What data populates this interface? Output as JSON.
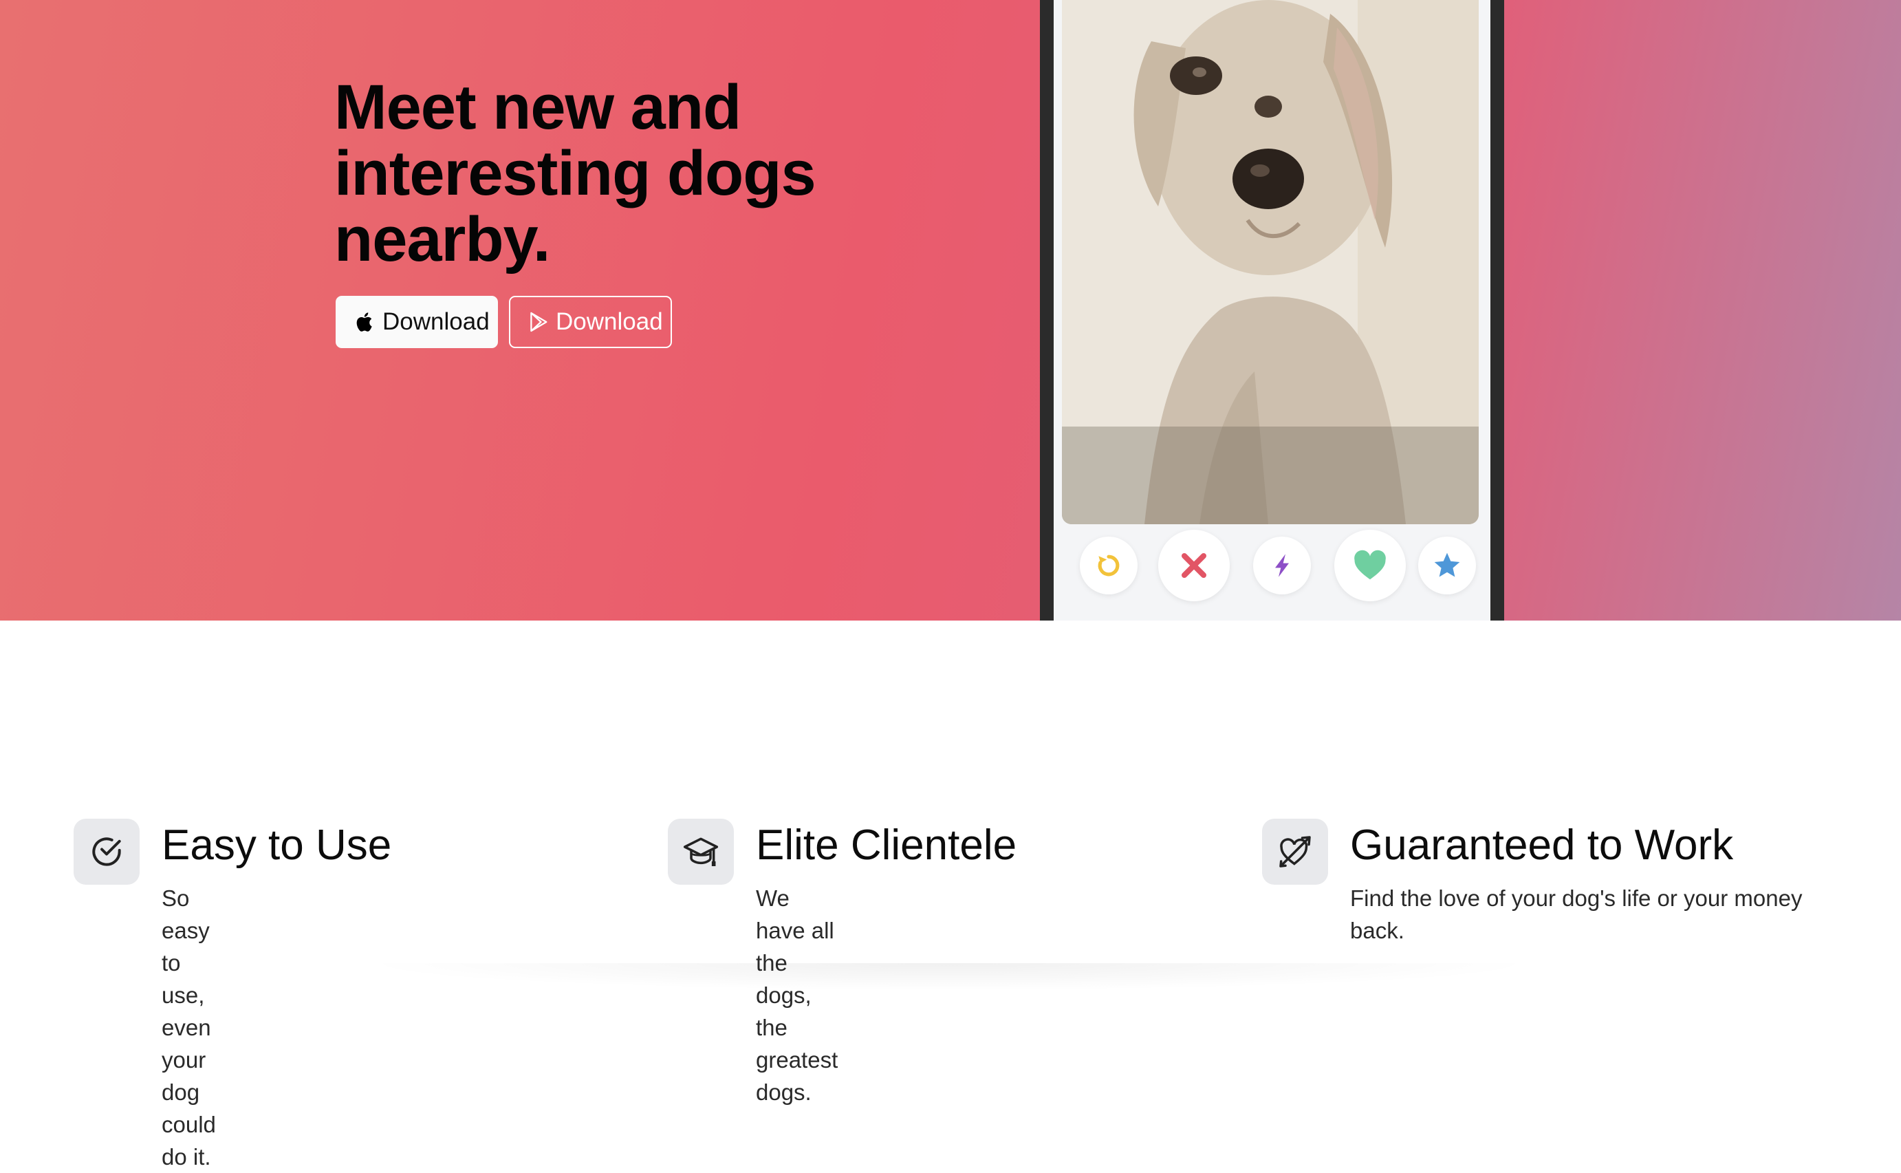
{
  "hero": {
    "title": "Meet new and interesting dogs nearby.",
    "apple_button_label": "Download",
    "play_button_label": "Download",
    "apple_icon": "apple-icon",
    "play_icon": "google-play-icon"
  },
  "phone": {
    "action_icons": [
      "rewind-icon",
      "nope-x-icon",
      "boost-bolt-icon",
      "like-heart-icon",
      "super-like-star-icon"
    ],
    "colors": {
      "rewind": "#f2c23a",
      "nope": "#e25565",
      "boost": "#8d4fc7",
      "like": "#6fcfa0",
      "super_like": "#4e97d8"
    }
  },
  "features": [
    {
      "icon": "check-circle-icon",
      "title": "Easy to Use",
      "description": "So easy to use, even your dog could do it."
    },
    {
      "icon": "graduation-cap-icon",
      "title": "Elite Clientele",
      "description": "We have all the dogs, the greatest dogs."
    },
    {
      "icon": "heart-arrow-icon",
      "title": "Guaranteed to Work",
      "description": "Find the love of your dog's life or your money back."
    }
  ]
}
